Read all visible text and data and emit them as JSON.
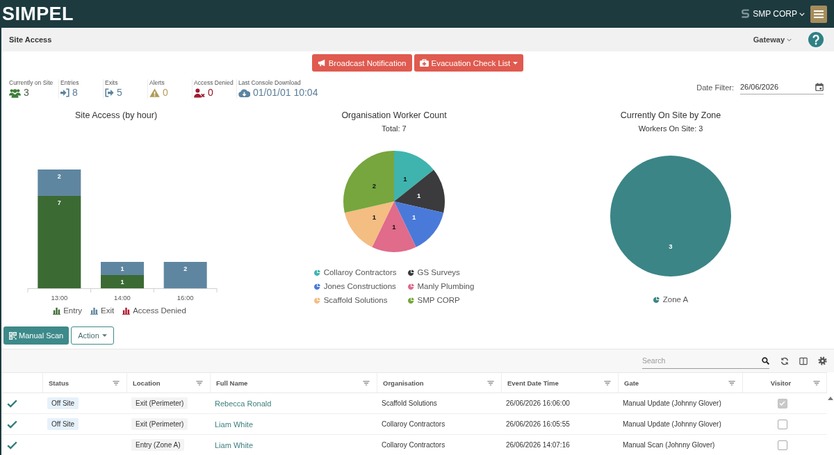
{
  "header": {
    "logo": "SIMPEL",
    "company": "SMP CORP"
  },
  "subheader": {
    "title": "Site Access",
    "menu": "Gateway"
  },
  "actions": [
    {
      "label": "Broadcast Notification",
      "kind": "broadcast",
      "dropdown": false
    },
    {
      "label": "Evacuation Check List",
      "kind": "evacuation",
      "dropdown": true
    }
  ],
  "stats": [
    {
      "label": "Currently on Site",
      "value": "3",
      "kind": "workers"
    },
    {
      "label": "Entries",
      "value": "8",
      "kind": "entries"
    },
    {
      "label": "Exits",
      "value": "5",
      "kind": "exits"
    },
    {
      "label": "Alerts",
      "value": "0",
      "kind": "alerts"
    },
    {
      "label": "Access Denied",
      "value": "0",
      "kind": "denied"
    },
    {
      "label": "Last Console Download",
      "value": "01/01/01 10:04",
      "kind": "download"
    }
  ],
  "date_filter": {
    "label": "Date Filter:",
    "value": "26/06/2026"
  },
  "charts": [
    {
      "chart_data": {
        "type": "bar",
        "title": "Site Access (by hour)",
        "categories": [
          "13:00",
          "14:00",
          "16:00"
        ],
        "stacked": true,
        "data_labels": true,
        "legend": "bottom",
        "series": [
          {
            "name": "Entry",
            "color": "#3b6a33",
            "values": [
              7,
              1,
              null
            ]
          },
          {
            "name": "Exit",
            "color": "#5f86a0",
            "values": [
              2,
              1,
              2
            ]
          },
          {
            "name": "Access Denied",
            "color": "#b0172e",
            "values": [
              null,
              null,
              null
            ]
          }
        ]
      }
    },
    {
      "chart_data": {
        "type": "pie",
        "title": "Organisation Worker Count",
        "subtitle": "Total: 7",
        "categories": [
          "Collaroy Contractors",
          "GS Surveys",
          "Jones Constructions",
          "Manly Plumbing",
          "Scaffold Solutions",
          "SMP CORP"
        ],
        "values": [
          1,
          1,
          1,
          1,
          1,
          2
        ],
        "colors": [
          "#3fb4ae",
          "#3b3a3d",
          "#4a7ad9",
          "#e06b8b",
          "#f4bd82",
          "#76a63d"
        ],
        "data_labels": true,
        "legend": "bottom"
      }
    },
    {
      "chart_data": {
        "type": "pie",
        "title": "Currently On Site by Zone",
        "subtitle": "Workers On Site: 3",
        "categories": [
          "Zone A"
        ],
        "values": [
          3
        ],
        "colors": [
          "#3b8587"
        ],
        "data_labels": true,
        "legend": "bottom"
      }
    }
  ],
  "table_actions": [
    {
      "label": "Manual Scan",
      "kind": "primary"
    },
    {
      "label": "Action",
      "kind": "dropdown"
    }
  ],
  "table": {
    "search": {
      "placeholder": "Search"
    },
    "columns": [
      "Status",
      "Location",
      "Full Name",
      "Organisation",
      "Event Date Time",
      "Gate",
      "Visitor"
    ],
    "rows": [
      {
        "ticked": true,
        "status": "Off Site",
        "location": "Exit (Perimeter)",
        "full_name": "Rebecca Ronald",
        "organisation": "Scaffold Solutions",
        "event_date_time": "26/06/2026 16:06:00",
        "gate": "Manual Update (Johnny Glover)",
        "visitor": true
      },
      {
        "ticked": true,
        "status": "Off Site",
        "location": "Exit (Perimeter)",
        "full_name": "Liam White",
        "organisation": "Collaroy Contractors",
        "event_date_time": "26/06/2026 16:05:55",
        "gate": "Manual Update (Johnny Glover)",
        "visitor": false
      },
      {
        "ticked": true,
        "location": "Entry (Zone A)",
        "full_name": "Liam White",
        "organisation": "Collaroy Contractors",
        "event_date_time": "26/06/2026 14:07:16",
        "gate": "Manual Scan (Johnny Glover)",
        "visitor": false
      }
    ]
  }
}
